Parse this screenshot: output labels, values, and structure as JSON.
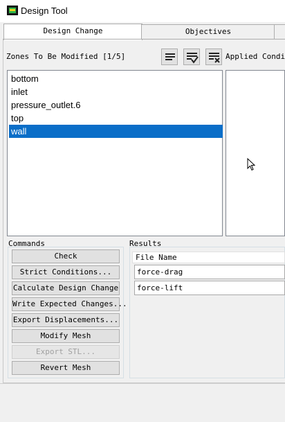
{
  "window": {
    "title": "Design Tool"
  },
  "tabs": [
    {
      "label": "Design Change",
      "active": true
    },
    {
      "label": "Objectives",
      "active": false
    }
  ],
  "zones": {
    "label": "Zones To Be Modified [1/5]",
    "items": [
      "bottom",
      "inlet",
      "pressure_outlet.6",
      "top",
      "wall"
    ],
    "selected_index": 4
  },
  "applied_conditions": {
    "label": "Applied Conditi"
  },
  "toolbar_icons": [
    "select-all-icon",
    "select-checked-icon",
    "clear-selection-icon"
  ],
  "commands": {
    "label": "Commands",
    "buttons": [
      {
        "label": "Check",
        "enabled": true
      },
      {
        "label": "Strict Conditions...",
        "enabled": true
      },
      {
        "label": "Calculate Design Change",
        "enabled": true
      },
      {
        "label": "Write Expected Changes...",
        "enabled": true
      },
      {
        "label": "Export Displacements...",
        "enabled": true
      },
      {
        "label": "Modify Mesh",
        "enabled": true
      },
      {
        "label": "Export STL...",
        "enabled": false
      },
      {
        "label": "Revert Mesh",
        "enabled": true
      }
    ]
  },
  "results": {
    "label": "Results",
    "column_header": "File Name",
    "rows": [
      "force-drag",
      "force-lift"
    ]
  },
  "colors": {
    "selection": "#0a6ec8",
    "window_bg": "#f0f0f0"
  }
}
